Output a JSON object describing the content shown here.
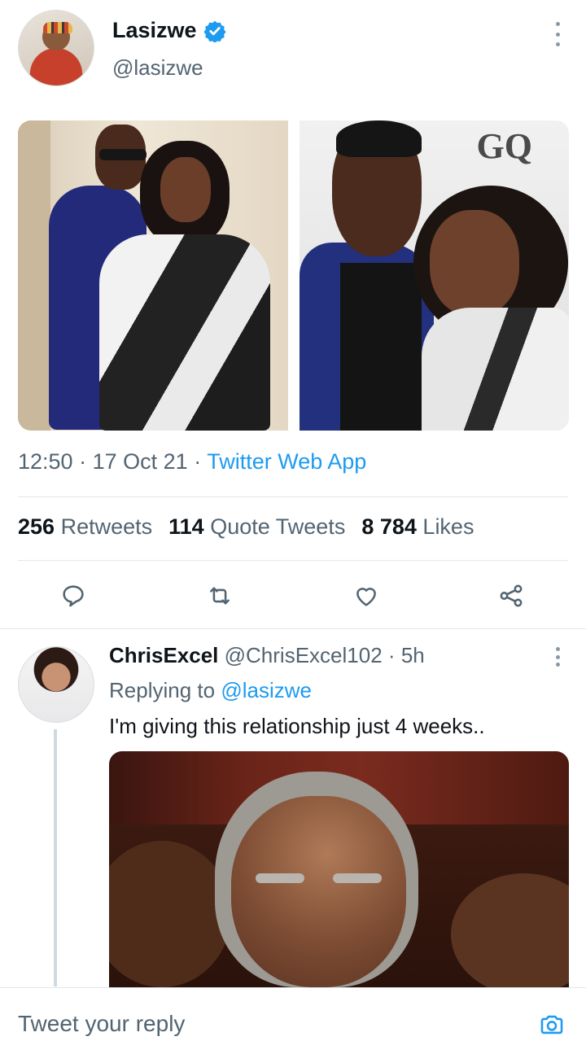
{
  "tweet": {
    "author": {
      "name": "Lasizwe",
      "handle": "@lasizwe",
      "verified": true
    },
    "time": "12:50",
    "date": "17 Oct 21",
    "source": "Twitter Web App",
    "separator": "·",
    "stats": {
      "retweets_count": "256",
      "retweets_label": "Retweets",
      "quotes_count": "114",
      "quotes_label": "Quote Tweets",
      "likes_count": "8 784",
      "likes_label": "Likes"
    },
    "actions": [
      {
        "name": "reply",
        "icon": "reply-icon"
      },
      {
        "name": "retweet",
        "icon": "retweet-icon"
      },
      {
        "name": "like",
        "icon": "heart-icon"
      },
      {
        "name": "share",
        "icon": "share-icon"
      }
    ]
  },
  "reply": {
    "name": "ChrisExcel",
    "handle": "@ChrisExcel102",
    "separator": "·",
    "time": "5h",
    "replying_prefix": "Replying to",
    "replying_to": "@lasizwe",
    "text": "I'm giving this relationship just 4 weeks.."
  },
  "composer": {
    "placeholder": "Tweet your reply"
  },
  "photo_text": {
    "logo": "GQ"
  },
  "colors": {
    "accent": "#1d9bf0",
    "secondary_text": "#536471",
    "divider": "#e1e8ed"
  }
}
